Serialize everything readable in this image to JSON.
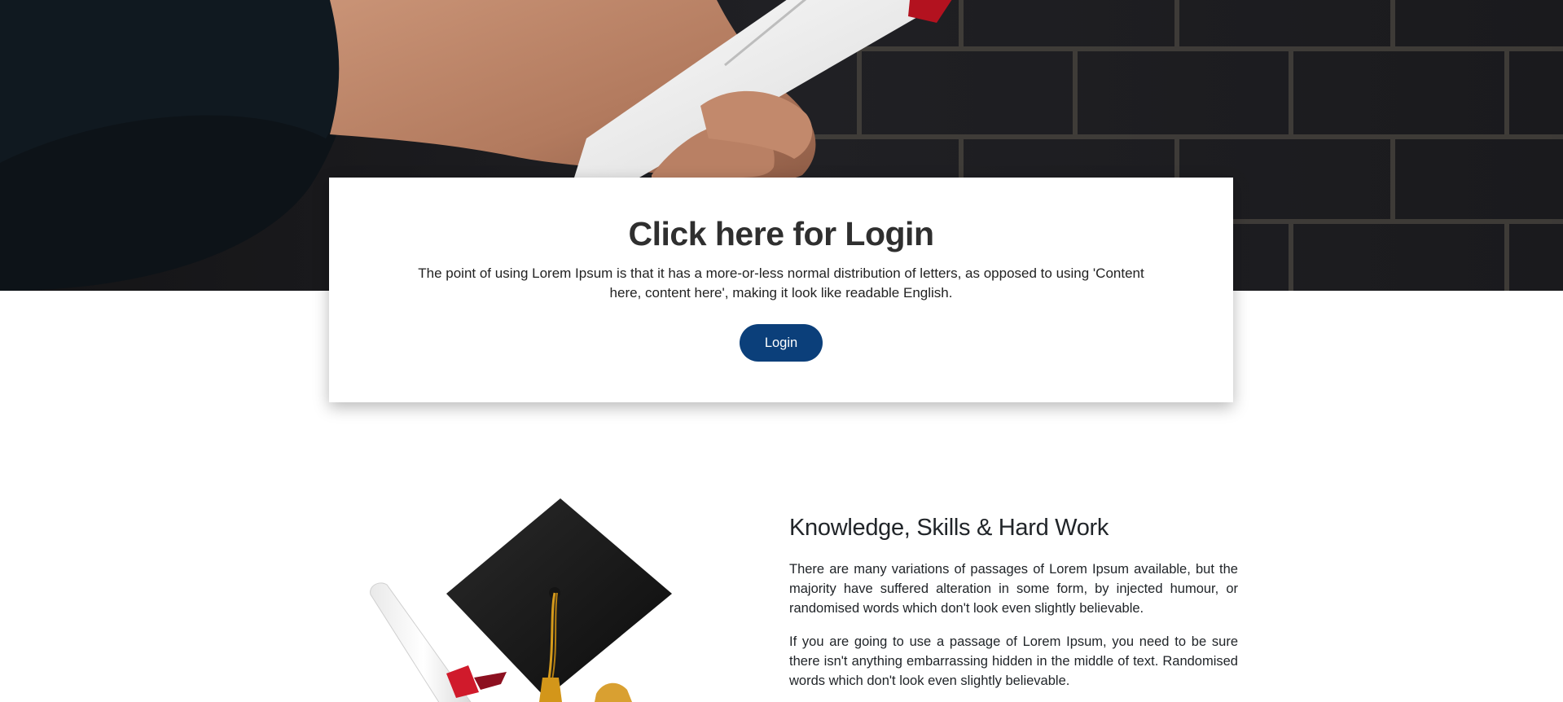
{
  "login": {
    "title": "Click here for Login",
    "text": "The point of using Lorem Ipsum is that it has a more-or-less normal distribution of letters, as opposed to using 'Content here, content here', making it look like readable English.",
    "button_label": "Login",
    "button_color": "#0b3f7a"
  },
  "about": {
    "title": "Knowledge, Skills & Hard Work",
    "paragraphs": [
      "There are many variations of passages of Lorem Ipsum available, but the majority have suffered alteration in some form, by injected humour, or randomised words which don't look even slightly believable.",
      "If you are going to use a passage of Lorem Ipsum, you need to be sure there isn't anything embarrassing hidden in the middle of text. Randomised words which don't look even slightly believable."
    ]
  },
  "images": {
    "hero": "graduate-hand-holding-diploma-photo",
    "illustration": "graduation-cap-and-diploma-icon"
  }
}
